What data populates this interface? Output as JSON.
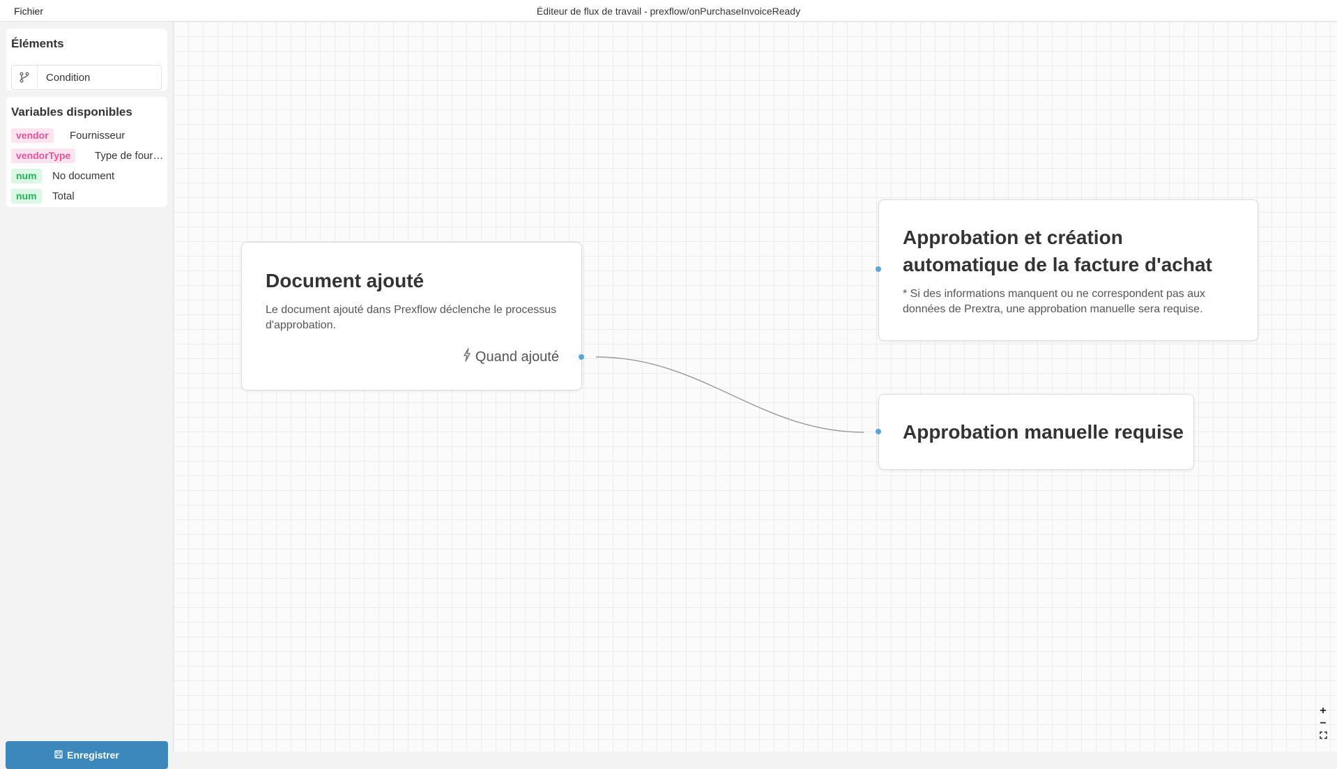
{
  "menu": {
    "file_label": "Fichier"
  },
  "window": {
    "title": "Éditeur de flux de travail - prexflow/onPurchaseInvoiceReady"
  },
  "sidebar": {
    "elements_title": "Éléments",
    "elements": [
      {
        "label": "Condition",
        "icon": "branch-icon"
      }
    ],
    "variables_title": "Variables disponibles",
    "variables": [
      {
        "tag": "vendor",
        "label": "Fournisseur",
        "color": "#e0559a"
      },
      {
        "tag": "vendorType",
        "label": "Type de four…",
        "color": "#e0559a"
      },
      {
        "tag": "num",
        "label": "No document",
        "color": "#22b35a"
      },
      {
        "tag": "num",
        "label": "Total",
        "color": "#22b35a"
      }
    ],
    "save_label": "Enregistrer"
  },
  "canvas": {
    "nodes": {
      "document_added": {
        "title": "Document ajouté",
        "description": "Le document ajouté dans Prexflow déclenche le processus d'approbation.",
        "trigger_label": "Quand ajouté"
      },
      "auto_approval": {
        "title": "Approbation et création automatique de la facture d'achat",
        "description": "* Si des informations manquent ou ne correspondent pas aux données de Prextra, une approbation manuelle sera requise."
      },
      "manual_approval": {
        "title": "Approbation manuelle requise"
      }
    },
    "zoom_controls": {
      "zoom_in": "+",
      "zoom_out": "−"
    }
  },
  "colors": {
    "accent": "#3c88bd",
    "handle": "#5aa4d6",
    "tag_pink": "#e0559a",
    "tag_green": "#22b35a"
  }
}
